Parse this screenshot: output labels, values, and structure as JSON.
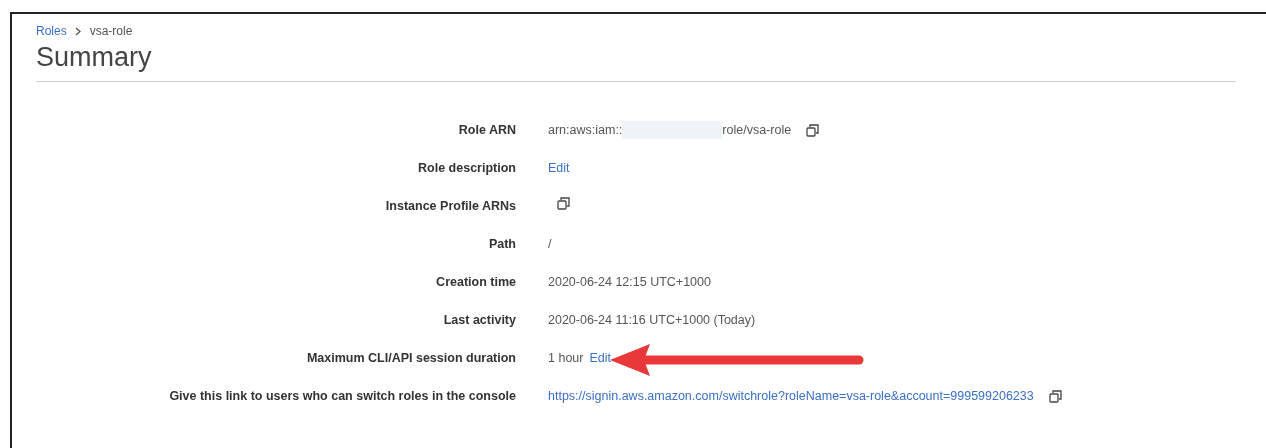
{
  "breadcrumb": [
    {
      "text": "Roles",
      "kind": "link"
    },
    {
      "text": "vsa-role",
      "kind": "current"
    }
  ],
  "title": "Summary",
  "rows": [
    {
      "label": "Role ARN",
      "value": [
        {
          "kind": "text",
          "text": "arn:aws:iam::"
        },
        {
          "kind": "redacted"
        },
        {
          "kind": "text",
          "text": "role/vsa-role"
        },
        {
          "kind": "copy"
        }
      ]
    },
    {
      "label": "Role description",
      "value": [
        {
          "kind": "link",
          "text": "Edit"
        }
      ]
    },
    {
      "label": "Instance Profile ARNs",
      "value": [
        {
          "kind": "copy"
        }
      ]
    },
    {
      "label": "Path",
      "value": [
        {
          "kind": "text",
          "text": "/"
        }
      ]
    },
    {
      "label": "Creation time",
      "value": [
        {
          "kind": "text",
          "text": "2020-06-24 12:15 UTC+1000"
        }
      ]
    },
    {
      "label": "Last activity",
      "value": [
        {
          "kind": "text",
          "text": "2020-06-24 11:16 UTC+1000 (Today)"
        }
      ]
    },
    {
      "label": "Maximum CLI/API session duration",
      "value": [
        {
          "kind": "text",
          "text": "1 hour"
        },
        {
          "kind": "link",
          "text": "Edit"
        }
      ]
    },
    {
      "label": "Give this link to users who can switch roles in the console",
      "value": [
        {
          "kind": "link",
          "text": "https://signin.aws.amazon.com/switchrole?roleName=vsa-role&account=999599206233"
        },
        {
          "kind": "copy"
        }
      ]
    }
  ]
}
